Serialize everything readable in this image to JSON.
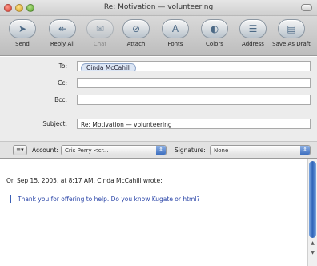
{
  "window": {
    "title": "Re: Motivation — volunteering"
  },
  "toolbar": {
    "buttons": [
      {
        "label": "Send",
        "icon": "send-icon",
        "glyph": "➤",
        "enabled": true
      },
      {
        "label": "Reply All",
        "icon": "reply-all-icon",
        "glyph": "↞",
        "enabled": true
      },
      {
        "label": "Chat",
        "icon": "chat-icon",
        "glyph": "✉",
        "enabled": false
      },
      {
        "label": "Attach",
        "icon": "attach-icon",
        "glyph": "⊘",
        "enabled": true
      },
      {
        "label": "Fonts",
        "icon": "fonts-icon",
        "glyph": "A",
        "enabled": true
      },
      {
        "label": "Colors",
        "icon": "colors-icon",
        "glyph": "◐",
        "enabled": true
      },
      {
        "label": "Address",
        "icon": "address-icon",
        "glyph": "☰",
        "enabled": true
      },
      {
        "label": "Save As Draft",
        "icon": "save-draft-icon",
        "glyph": "▤",
        "enabled": true
      }
    ]
  },
  "fields": {
    "to_label": "To:",
    "to_value": "Cinda McCahill",
    "cc_label": "Cc:",
    "cc_value": "",
    "bcc_label": "Bcc:",
    "bcc_value": "",
    "subject_label": "Subject:",
    "subject_value": "Re: Motivation — volunteering"
  },
  "options": {
    "account_label": "Account:",
    "account_value": "Cris Perry <cr...",
    "signature_label": "Signature:",
    "signature_value": "None"
  },
  "message": {
    "quote_header": "On Sep 15, 2005, at 8:17 AM, Cinda McCahill wrote:",
    "quote_text": "Thank you for offering to help. Do you know Kugate or html?"
  },
  "colors": {
    "accent": "#3d6fbf",
    "quote": "#2a45a8"
  }
}
